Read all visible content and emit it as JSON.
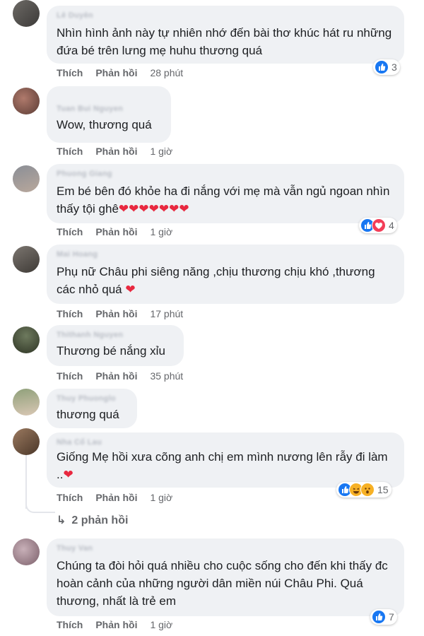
{
  "labels": {
    "like": "Thích",
    "reply": "Phản hồi"
  },
  "colors": {
    "like_blue": "#1877f2",
    "love_red": "#f33e58",
    "haha_yellow": "#f7b125",
    "bubble_bg": "#eff1f4"
  },
  "comments": [
    {
      "name": "Lê Duyên",
      "text": "Nhìn hình ảnh này tự nhiên nhớ đến bài thơ khúc hát ru những đứa bé trên lưng mẹ huhu thương quá",
      "time": "28 phút",
      "reactions": [
        "like"
      ],
      "count": "3"
    },
    {
      "name": "Tuan Bui Nguyen",
      "text": "Wow, thương quá",
      "time": "1 giờ"
    },
    {
      "name": "Phuong Giang",
      "text": "Em bé bên đó khỏe ha đi nắng với mẹ mà vẫn ngủ ngoan nhìn thấy tội ghê",
      "hearts": "❤❤❤❤❤❤❤",
      "time": "1 giờ",
      "reactions": [
        "like",
        "love"
      ],
      "count": "4"
    },
    {
      "name": "Mai Hoang",
      "text": "Phụ nữ Châu phi siêng năng ,chịu thương chịu khó ,thương các nhỏ quá ",
      "hearts": "❤",
      "time": "17 phút"
    },
    {
      "name": "Thithanh Nguyen",
      "text": "Thương bé nắng xỉu",
      "time": "35 phút"
    },
    {
      "name": "Thuy Phuonglo",
      "text": "thương quá"
    },
    {
      "name": "Nha Cổ Lau",
      "text": "Giống Mẹ hồi xưa cõng anh chị em mình nương lên rẫy đi làm ..",
      "hearts": "❤",
      "time": "1 giờ",
      "reactions": [
        "like",
        "haha",
        "wow"
      ],
      "count": "15"
    },
    {
      "name": "Thuy Van",
      "text": "Chúng ta đòi hỏi quá nhiều cho cuộc sống cho đến khi thấy đc hoàn cảnh của những người dân miền núi Châu Phi. Quá thương, nhất là trẻ em",
      "time": "1 giờ",
      "reactions": [
        "like"
      ],
      "count": "7"
    }
  ],
  "replies_link": "2 phản hồi",
  "replies_arrow": "↳"
}
